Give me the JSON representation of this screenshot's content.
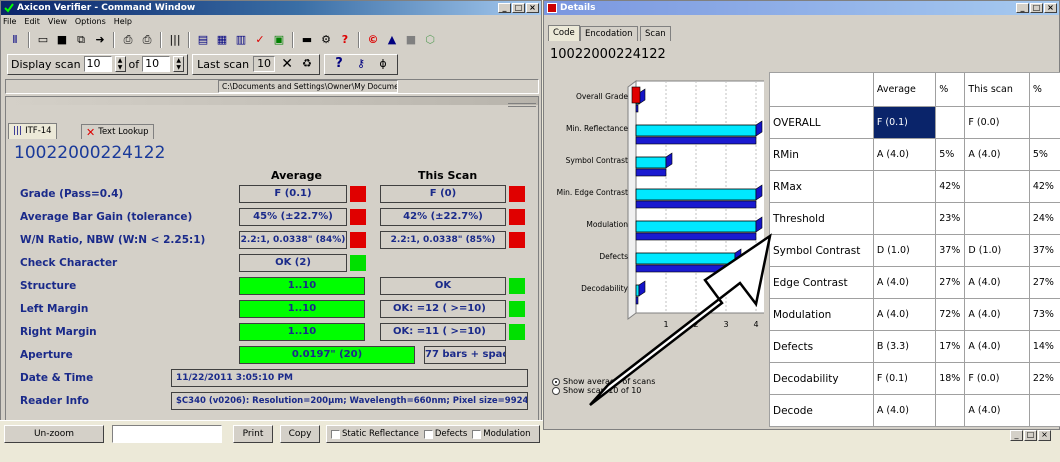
{
  "cmd": {
    "title": "Axicon Verifier - Command Window",
    "menu": [
      "File",
      "Edit",
      "View",
      "Options",
      "Help"
    ],
    "display_scan_label": "Display scan",
    "display_scan_value": "10",
    "of_label": "of",
    "of_value": "10",
    "last_scan_label": "Last scan",
    "last_scan_value": "10",
    "path": "C:\\Documents and Settings\\Owner\\My Documen"
  },
  "inner": {
    "tabs": [
      "ITF-14",
      "Text Lookup"
    ],
    "code": "10022000224122",
    "col_average": "Average",
    "col_this_scan": "This Scan",
    "rows": [
      {
        "label": "Grade (Pass=0.4)",
        "avg": "F (0.1)",
        "this": "F (0)"
      },
      {
        "label": "Average Bar Gain (tolerance)",
        "avg": "45% (±22.7%)",
        "this": "42% (±22.7%)"
      },
      {
        "label": "W/N Ratio, NBW (W:N < 2.25:1)",
        "avg": "2.2:1, 0.0338\" (84%)",
        "this": "2.2:1, 0.0338\" (85%)"
      },
      {
        "label": "Check Character",
        "avg": "OK (2)",
        "this": ""
      },
      {
        "label": "Structure",
        "avg": "1..10",
        "this": "OK"
      },
      {
        "label": "Left Margin",
        "avg": "1..10",
        "this": "OK:   =12 ( >=10)"
      },
      {
        "label": "Right Margin",
        "avg": "1..10",
        "this": "OK:   =11 ( >=10)"
      },
      {
        "label": "Aperture",
        "avg": "0.0197\" (20)",
        "this": "77 bars + spaces"
      }
    ],
    "date_label": "Date & Time",
    "date_value": "11/22/2011 3:05:10 PM",
    "reader_label": "Reader Info",
    "reader_value": "$C340 (v0206): Resolution=200µm; Wavelength=660nm; Pixel size=99247r"
  },
  "bottom": {
    "unzoom": "Un-zoom",
    "print": "Print",
    "copy": "Copy",
    "checks": [
      "Static Reflectance",
      "Defects",
      "Modulation"
    ]
  },
  "details": {
    "title": "Details",
    "tabs": [
      "Code",
      "Encodation",
      "Scan"
    ],
    "code": "10022000224122",
    "chart_labels": [
      "Overall Grade",
      "Min. Reflectance",
      "Symbol Contrast",
      "Min. Edge Contrast",
      "Modulation",
      "Defects",
      "Decodability"
    ],
    "axis_ticks": [
      "1",
      "2",
      "3",
      "4"
    ],
    "radio": [
      "Show average of scans",
      "Show scan 10 of 10"
    ],
    "headers": [
      "",
      "Average",
      "%",
      "This scan",
      "%"
    ],
    "table": [
      [
        "OVERALL",
        "F (0.1)",
        "",
        "F (0.0)",
        ""
      ],
      [
        "RMin",
        "A (4.0)",
        "5%",
        "A (4.0)",
        "5%"
      ],
      [
        "RMax",
        "",
        "42%",
        "",
        "42%"
      ],
      [
        "Threshold",
        "",
        "23%",
        "",
        "24%"
      ],
      [
        "Symbol Contrast",
        "D (1.0)",
        "37%",
        "D (1.0)",
        "37%"
      ],
      [
        "Edge Contrast",
        "A (4.0)",
        "27%",
        "A (4.0)",
        "27%"
      ],
      [
        "Modulation",
        "A (4.0)",
        "72%",
        "A (4.0)",
        "73%"
      ],
      [
        "Defects",
        "B (3.3)",
        "17%",
        "A (4.0)",
        "14%"
      ],
      [
        "Decodability",
        "F (0.1)",
        "18%",
        "F (0.0)",
        "22%"
      ],
      [
        "Decode",
        "A (4.0)",
        "",
        "A (4.0)",
        ""
      ]
    ]
  },
  "chart_data": {
    "type": "bar",
    "categories": [
      "Overall Grade",
      "Min. Reflectance",
      "Symbol Contrast",
      "Min. Edge Contrast",
      "Modulation",
      "Defects",
      "Decodability"
    ],
    "series": [
      {
        "values": [
          0.1,
          4.0,
          1.0,
          4.0,
          4.0,
          3.3,
          0.1
        ]
      },
      {
        "values": [
          0.0,
          4.0,
          1.0,
          4.0,
          4.0,
          4.0,
          0.0
        ]
      }
    ],
    "xlim": [
      0,
      4
    ]
  }
}
